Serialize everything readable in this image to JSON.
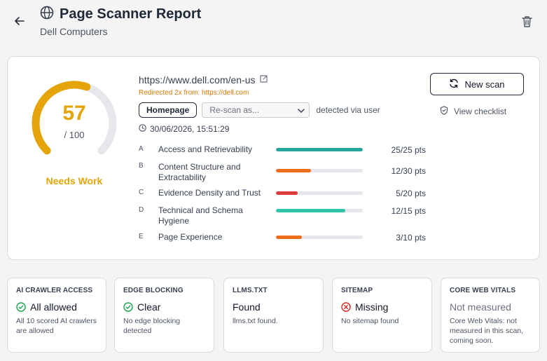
{
  "header": {
    "title": "Page Scanner Report",
    "subtitle": "Dell Computers"
  },
  "report": {
    "score": "57",
    "score_max": "/ 100",
    "score_fraction": 0.57,
    "status": "Needs Work",
    "url": "https://www.dell.com/en-us",
    "redirect": "Redirected 2x from: https://dell.com",
    "page_type": "Homepage",
    "rescan_placeholder": "Re-scan as...",
    "detected": "detected via user",
    "timestamp": "30/06/2026, 15:51:29",
    "new_scan_label": "New scan",
    "view_checklist_label": "View checklist",
    "colors": {
      "gauge": "#e5a50a",
      "teal": "#26a69a",
      "orange": "#ef6c1a",
      "red": "#dc3b3b",
      "mint": "#2ec4a8"
    },
    "criteria": [
      {
        "letter": "A",
        "name": "Access and Retrievability",
        "points": "25/25 pts",
        "fraction": 1.0,
        "color": "#26a69a"
      },
      {
        "letter": "B",
        "name": "Content Structure and Extractability",
        "points": "12/30 pts",
        "fraction": 0.4,
        "color": "#ef6c1a"
      },
      {
        "letter": "C",
        "name": "Evidence Density and Trust",
        "points": "5/20 pts",
        "fraction": 0.25,
        "color": "#dc3b3b"
      },
      {
        "letter": "D",
        "name": "Technical and Schema Hygiene",
        "points": "12/15 pts",
        "fraction": 0.8,
        "color": "#2ec4a8"
      },
      {
        "letter": "E",
        "name": "Page Experience",
        "points": "3/10 pts",
        "fraction": 0.3,
        "color": "#ef6c1a"
      }
    ]
  },
  "tiles": [
    {
      "label": "AI CRAWLER ACCESS",
      "value": "All allowed",
      "desc": "All 10 scored AI crawlers are allowed",
      "icon": "check-circle-icon"
    },
    {
      "label": "EDGE BLOCKING",
      "value": "Clear",
      "desc": "No edge blocking detected",
      "icon": "check-circle-icon"
    },
    {
      "label": "LLMS.TXT",
      "value": "Found",
      "desc": "llms.txt found.",
      "icon": ""
    },
    {
      "label": "SITEMAP",
      "value": "Missing",
      "desc": "No sitemap found",
      "icon": "x-circle-icon"
    },
    {
      "label": "CORE WEB VITALS",
      "value": "Not measured",
      "desc": "Core Web Vitals: not measured in this scan, coming soon.",
      "icon": ""
    }
  ]
}
